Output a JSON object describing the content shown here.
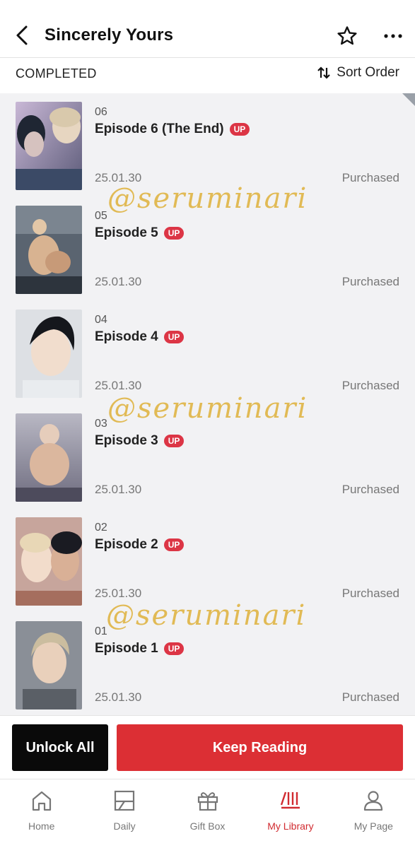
{
  "header": {
    "title": "Sincerely Yours"
  },
  "subbar": {
    "status": "COMPLETED",
    "sort_label": "Sort Order"
  },
  "episodes": [
    {
      "number": "06",
      "title": "Episode 6 (The End)",
      "badge": "UP",
      "date": "25.01.30",
      "status": "Purchased"
    },
    {
      "number": "05",
      "title": "Episode 5",
      "badge": "UP",
      "date": "25.01.30",
      "status": "Purchased"
    },
    {
      "number": "04",
      "title": "Episode 4",
      "badge": "UP",
      "date": "25.01.30",
      "status": "Purchased"
    },
    {
      "number": "03",
      "title": "Episode 3",
      "badge": "UP",
      "date": "25.01.30",
      "status": "Purchased"
    },
    {
      "number": "02",
      "title": "Episode 2",
      "badge": "UP",
      "date": "25.01.30",
      "status": "Purchased"
    },
    {
      "number": "01",
      "title": "Episode 1",
      "badge": "UP",
      "date": "25.01.30",
      "status": "Purchased"
    }
  ],
  "watermark": "@seruminari",
  "actions": {
    "unlock_all": "Unlock All",
    "keep_reading": "Keep Reading"
  },
  "nav": {
    "items": [
      {
        "label": "Home",
        "icon": "home-icon"
      },
      {
        "label": "Daily",
        "icon": "calendar-icon"
      },
      {
        "label": "Gift Box",
        "icon": "gift-icon"
      },
      {
        "label": "My Library",
        "icon": "library-icon",
        "active": true
      },
      {
        "label": "My Page",
        "icon": "person-icon"
      }
    ]
  },
  "colors": {
    "accent": "#dc2f34",
    "badge": "#dc3545",
    "watermark": "#e0b544",
    "list_background": "#f2f2f4"
  }
}
